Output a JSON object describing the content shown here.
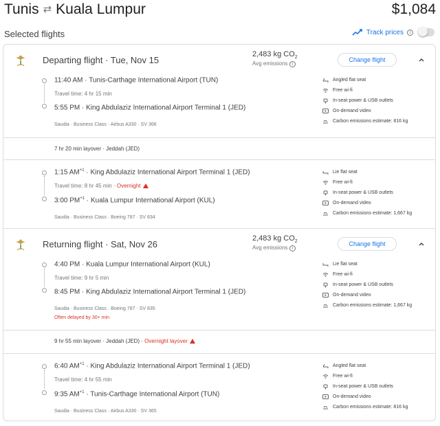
{
  "header": {
    "origin": "Tunis",
    "swap_icon": "⇄",
    "destination": "Kuala Lumpur",
    "price": "$1,084"
  },
  "selected_label": "Selected flights",
  "track": {
    "label": "Track prices",
    "toggled": false
  },
  "colors": {
    "accent": "#1a73e8",
    "warning": "#d93025",
    "border": "#dadce0",
    "muted": "#70757a"
  },
  "departing": {
    "title": "Departing flight",
    "date": "Tue, Nov 15",
    "co2_value": "2,483 kg CO",
    "co2_sub": "2",
    "co2_label": "Avg emissions",
    "change_label": "Change flight",
    "legs": [
      {
        "dep_time": "11:40 AM",
        "dep_sup": "",
        "dep_airport": "Tunis-Carthage International Airport (TUN)",
        "travel": "Travel time: 4 hr 15 min",
        "overnight": "",
        "arr_time": "5:55 PM",
        "arr_sup": "",
        "arr_airport": "King Abdulaziz International Airport Terminal 1 (JED)",
        "meta": "Saudia · Business Class · Airbus A330 · SV 366",
        "amenities": [
          {
            "icon": "seat-icon",
            "label": "Angled flat seat"
          },
          {
            "icon": "wifi-icon",
            "label": "Free wi-fi"
          },
          {
            "icon": "power-icon",
            "label": "In-seat power & USB outlets"
          },
          {
            "icon": "video-icon",
            "label": "On-demand video"
          },
          {
            "icon": "co2-icon",
            "label": "Carbon emissions estimate: 816 kg"
          }
        ]
      },
      {
        "dep_time": "1:15 AM",
        "dep_sup": "+1",
        "dep_airport": "King Abdulaziz International Airport Terminal 1 (JED)",
        "travel": "Travel time: 8 hr 45 min",
        "overnight": "Overnight",
        "arr_time": "3:00 PM",
        "arr_sup": "+1",
        "arr_airport": "Kuala Lumpur International Airport (KUL)",
        "meta": "Saudia · Business Class · Boeing 787 · SV 834",
        "amenities": [
          {
            "icon": "seat-icon",
            "label": "Lie flat seat"
          },
          {
            "icon": "wifi-icon",
            "label": "Free wi-fi"
          },
          {
            "icon": "power-icon",
            "label": "In-seat power & USB outlets"
          },
          {
            "icon": "video-icon",
            "label": "On-demand video"
          },
          {
            "icon": "co2-icon",
            "label": "Carbon emissions estimate: 1,667 kg"
          }
        ]
      }
    ],
    "layover": "7 hr 20 min layover · Jeddah (JED)",
    "layover_warning": ""
  },
  "returning": {
    "title": "Returning flight",
    "date": "Sat, Nov 26",
    "co2_value": "2,483 kg CO",
    "co2_sub": "2",
    "co2_label": "Avg emissions",
    "change_label": "Change flight",
    "legs": [
      {
        "dep_time": "4:40 PM",
        "dep_sup": "",
        "dep_airport": "Kuala Lumpur International Airport (KUL)",
        "travel": "Travel time: 9 hr 5 min",
        "overnight": "",
        "arr_time": "8:45 PM",
        "arr_sup": "",
        "arr_airport": "King Abdulaziz International Airport Terminal 1 (JED)",
        "meta": "Saudia · Business Class · Boeing 787 · SV 835",
        "delay": "Often delayed by 30+ min",
        "amenities": [
          {
            "icon": "seat-icon",
            "label": "Lie flat seat"
          },
          {
            "icon": "wifi-icon",
            "label": "Free wi-fi"
          },
          {
            "icon": "power-icon",
            "label": "In-seat power & USB outlets"
          },
          {
            "icon": "video-icon",
            "label": "On-demand video"
          },
          {
            "icon": "co2-icon",
            "label": "Carbon emissions estimate: 1,667 kg"
          }
        ]
      },
      {
        "dep_time": "6:40 AM",
        "dep_sup": "+1",
        "dep_airport": "King Abdulaziz International Airport Terminal 1 (JED)",
        "travel": "Travel time: 4 hr 55 min",
        "overnight": "",
        "arr_time": "9:35 AM",
        "arr_sup": "+1",
        "arr_airport": "Tunis-Carthage International Airport (TUN)",
        "meta": "Saudia · Business Class · Airbus A330 · SV 365",
        "amenities": [
          {
            "icon": "seat-icon",
            "label": "Angled flat seat"
          },
          {
            "icon": "wifi-icon",
            "label": "Free wi-fi"
          },
          {
            "icon": "power-icon",
            "label": "In-seat power & USB outlets"
          },
          {
            "icon": "video-icon",
            "label": "On-demand video"
          },
          {
            "icon": "co2-icon",
            "label": "Carbon emissions estimate: 816 kg"
          }
        ]
      }
    ],
    "layover": "9 hr 55 min layover · Jeddah (JED)",
    "layover_warning": "Overnight layover"
  }
}
